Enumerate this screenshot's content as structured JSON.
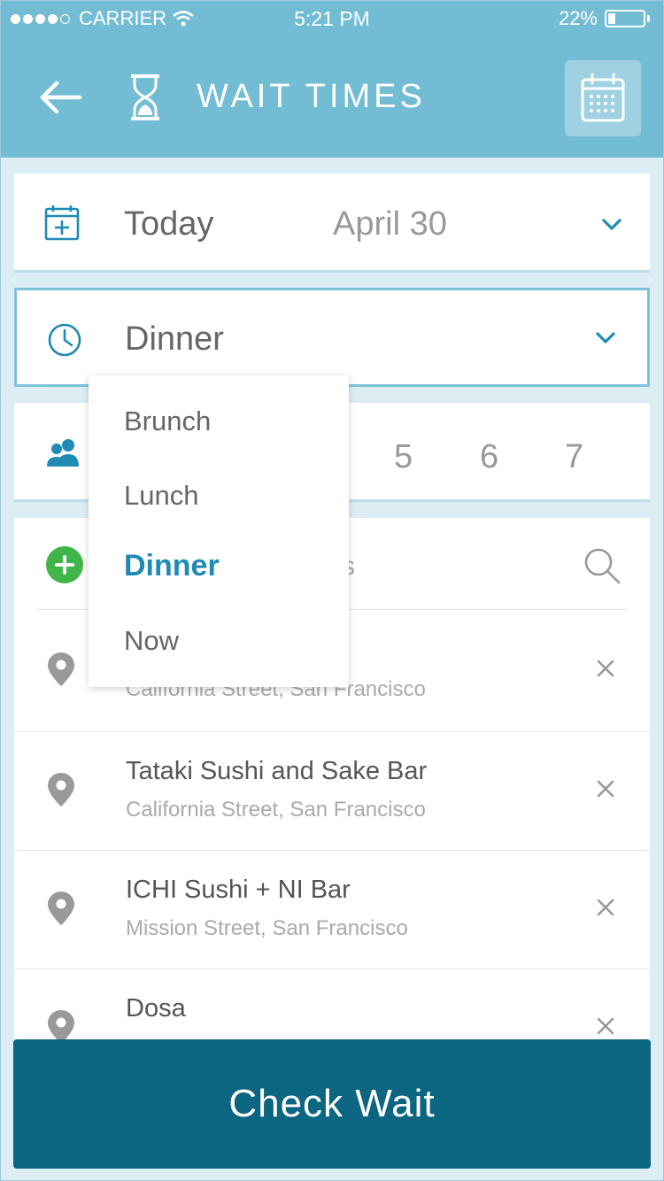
{
  "status_bar": {
    "carrier": "CARRIER",
    "time": "5:21 PM",
    "battery": "22%",
    "battery_level": 0.22
  },
  "header": {
    "title": "WAIT TIMES",
    "background": "#72bcd4"
  },
  "date_row": {
    "label": "Today",
    "value": "April 30"
  },
  "meal_row": {
    "label": "Dinner"
  },
  "party_row": {
    "sizes": [
      "5",
      "6",
      "7"
    ]
  },
  "meal_dropdown": {
    "options": [
      "Brunch",
      "Lunch",
      "Dinner",
      "Now"
    ],
    "selected": "Dinner",
    "accent_color": "#1f8ab3"
  },
  "search_row": {
    "partial_text": "s"
  },
  "places": [
    {
      "name": "",
      "address": "California Street, San Francisco"
    },
    {
      "name": "Tataki Sushi and Sake Bar",
      "address": "California Street, San Francisco"
    },
    {
      "name": "ICHI Sushi + NI Bar",
      "address": "Mission Street, San Francisco"
    },
    {
      "name": "Dosa",
      "address": ""
    }
  ],
  "cta": {
    "label": "Check Wait",
    "color": "#0c6581"
  },
  "icons": {
    "back": "arrow-left-icon",
    "hourglass": "hourglass-icon",
    "calendar": "calendar-icon",
    "clock": "clock-icon",
    "people": "people-icon",
    "add": "plus-circle-icon",
    "search": "search-icon",
    "pin": "map-pin-icon",
    "remove": "close-icon"
  }
}
